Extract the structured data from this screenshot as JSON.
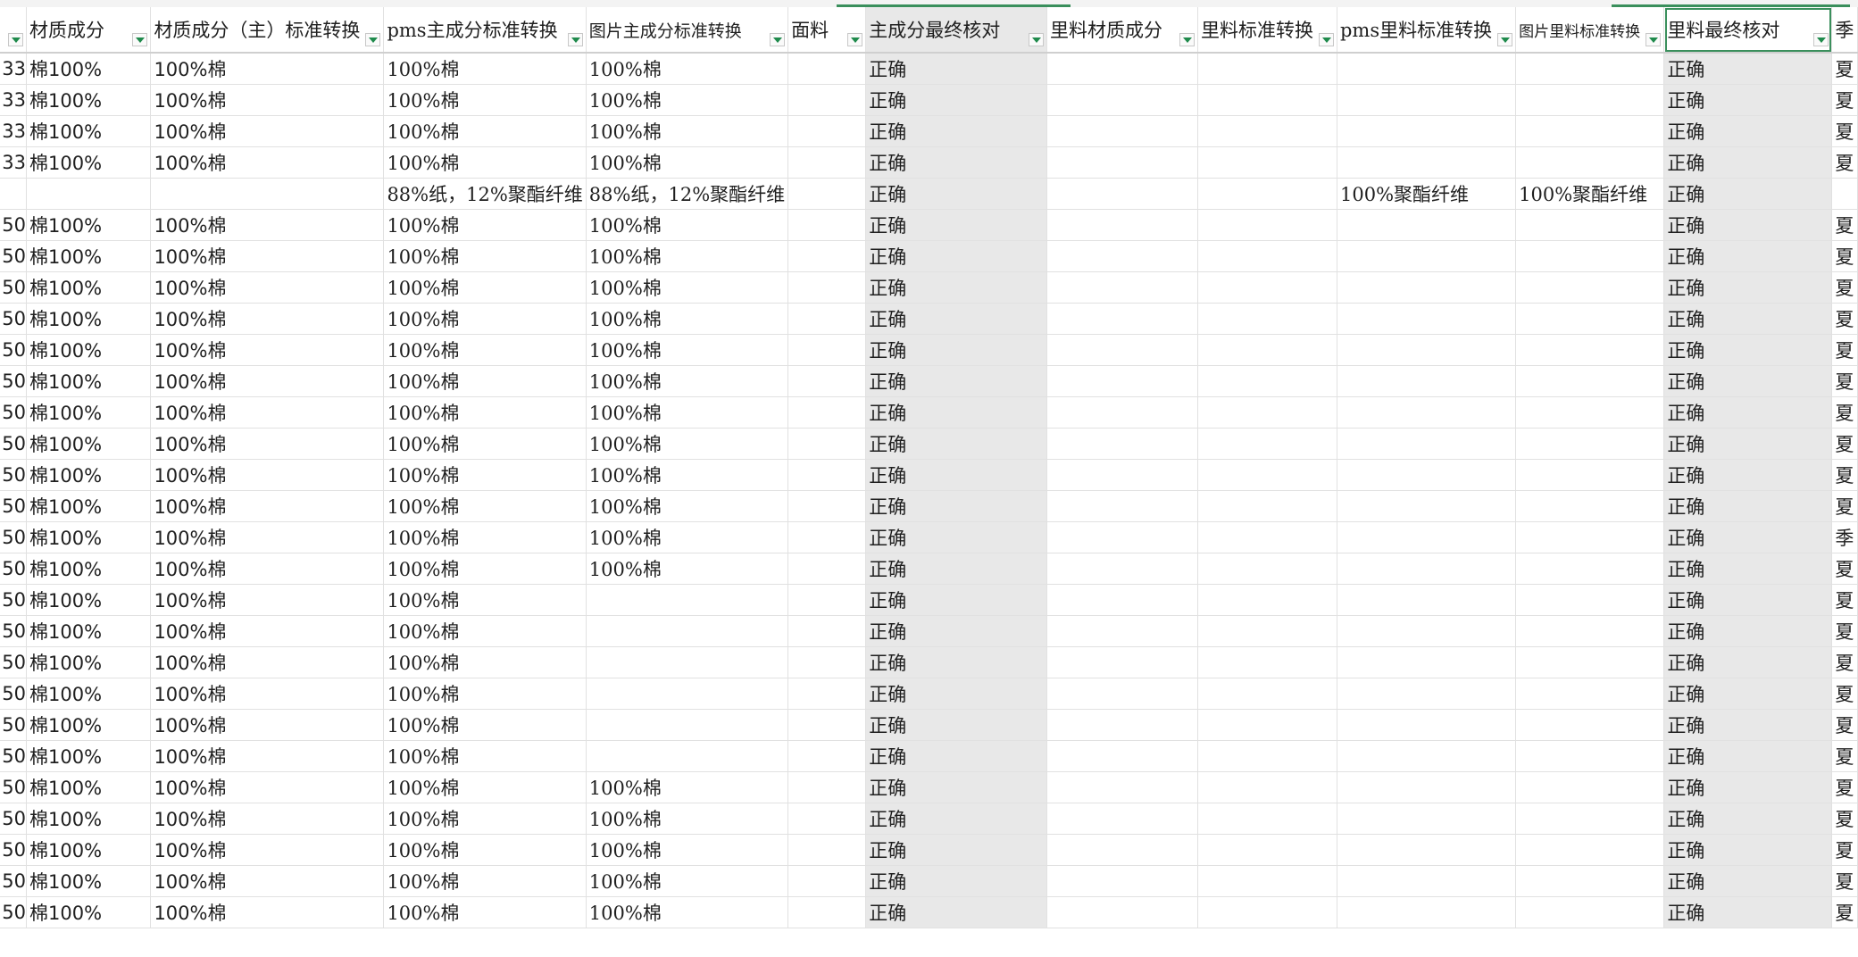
{
  "headers": [
    "",
    "材质成分",
    "材质成分（主）标准转换",
    "pms主成分标准转换",
    "图片主成分标准转换",
    "面料",
    "主成分最终核对",
    "里料材质成分",
    "里料标准转换",
    "pms里料标准转换",
    "图片里料标准转换",
    "里料最终核对",
    "季"
  ],
  "rows": [
    [
      "33",
      "棉100%",
      "100%棉",
      "100%棉",
      "100%棉",
      "",
      "正确",
      "",
      "",
      "",
      "",
      "正确",
      "夏"
    ],
    [
      "33",
      "棉100%",
      "100%棉",
      "100%棉",
      "100%棉",
      "",
      "正确",
      "",
      "",
      "",
      "",
      "正确",
      "夏"
    ],
    [
      "33",
      "棉100%",
      "100%棉",
      "100%棉",
      "100%棉",
      "",
      "正确",
      "",
      "",
      "",
      "",
      "正确",
      "夏"
    ],
    [
      "33",
      "棉100%",
      "100%棉",
      "100%棉",
      "100%棉",
      "",
      "正确",
      "",
      "",
      "",
      "",
      "正确",
      "夏"
    ],
    [
      "",
      "",
      "",
      "88%纸，12%聚酯纤维",
      "88%纸，12%聚酯纤维",
      "",
      "正确",
      "",
      "",
      "100%聚酯纤维",
      "100%聚酯纤维",
      "正确",
      ""
    ],
    [
      "50",
      "棉100%",
      "100%棉",
      "100%棉",
      "100%棉",
      "",
      "正确",
      "",
      "",
      "",
      "",
      "正确",
      "夏"
    ],
    [
      "50",
      "棉100%",
      "100%棉",
      "100%棉",
      "100%棉",
      "",
      "正确",
      "",
      "",
      "",
      "",
      "正确",
      "夏"
    ],
    [
      "50",
      "棉100%",
      "100%棉",
      "100%棉",
      "100%棉",
      "",
      "正确",
      "",
      "",
      "",
      "",
      "正确",
      "夏"
    ],
    [
      "50",
      "棉100%",
      "100%棉",
      "100%棉",
      "100%棉",
      "",
      "正确",
      "",
      "",
      "",
      "",
      "正确",
      "夏"
    ],
    [
      "50",
      "棉100%",
      "100%棉",
      "100%棉",
      "100%棉",
      "",
      "正确",
      "",
      "",
      "",
      "",
      "正确",
      "夏"
    ],
    [
      "50",
      "棉100%",
      "100%棉",
      "100%棉",
      "100%棉",
      "",
      "正确",
      "",
      "",
      "",
      "",
      "正确",
      "夏"
    ],
    [
      "50",
      "棉100%",
      "100%棉",
      "100%棉",
      "100%棉",
      "",
      "正确",
      "",
      "",
      "",
      "",
      "正确",
      "夏"
    ],
    [
      "50",
      "棉100%",
      "100%棉",
      "100%棉",
      "100%棉",
      "",
      "正确",
      "",
      "",
      "",
      "",
      "正确",
      "夏"
    ],
    [
      "50",
      "棉100%",
      "100%棉",
      "100%棉",
      "100%棉",
      "",
      "正确",
      "",
      "",
      "",
      "",
      "正确",
      "夏"
    ],
    [
      "50",
      "棉100%",
      "100%棉",
      "100%棉",
      "100%棉",
      "",
      "正确",
      "",
      "",
      "",
      "",
      "正确",
      "夏"
    ],
    [
      "50",
      "棉100%",
      "100%棉",
      "100%棉",
      "100%棉",
      "",
      "正确",
      "",
      "",
      "",
      "",
      "正确",
      "季"
    ],
    [
      "50",
      "棉100%",
      "100%棉",
      "100%棉",
      "100%棉",
      "",
      "正确",
      "",
      "",
      "",
      "",
      "正确",
      "夏"
    ],
    [
      "50",
      "棉100%",
      "100%棉",
      "100%棉",
      "",
      "",
      "正确",
      "",
      "",
      "",
      "",
      "正确",
      "夏"
    ],
    [
      "50",
      "棉100%",
      "100%棉",
      "100%棉",
      "",
      "",
      "正确",
      "",
      "",
      "",
      "",
      "正确",
      "夏"
    ],
    [
      "50",
      "棉100%",
      "100%棉",
      "100%棉",
      "",
      "",
      "正确",
      "",
      "",
      "",
      "",
      "正确",
      "夏"
    ],
    [
      "50",
      "棉100%",
      "100%棉",
      "100%棉",
      "",
      "",
      "正确",
      "",
      "",
      "",
      "",
      "正确",
      "夏"
    ],
    [
      "50",
      "棉100%",
      "100%棉",
      "100%棉",
      "",
      "",
      "正确",
      "",
      "",
      "",
      "",
      "正确",
      "夏"
    ],
    [
      "50",
      "棉100%",
      "100%棉",
      "100%棉",
      "",
      "",
      "正确",
      "",
      "",
      "",
      "",
      "正确",
      "夏"
    ],
    [
      "50",
      "棉100%",
      "100%棉",
      "100%棉",
      "100%棉",
      "",
      "正确",
      "",
      "",
      "",
      "",
      "正确",
      "夏"
    ],
    [
      "50",
      "棉100%",
      "100%棉",
      "100%棉",
      "100%棉",
      "",
      "正确",
      "",
      "",
      "",
      "",
      "正确",
      "夏"
    ],
    [
      "50",
      "棉100%",
      "100%棉",
      "100%棉",
      "100%棉",
      "",
      "正确",
      "",
      "",
      "",
      "",
      "正确",
      "夏"
    ],
    [
      "50",
      "棉100%",
      "100%棉",
      "100%棉",
      "100%棉",
      "",
      "正确",
      "",
      "",
      "",
      "",
      "正确",
      "夏"
    ],
    [
      "50",
      "棉100%",
      "100%棉",
      "100%棉",
      "100%棉",
      "",
      "正确",
      "",
      "",
      "",
      "",
      "正确",
      "夏"
    ]
  ],
  "colors": {
    "accent": "#3a8f5c",
    "filter_arrow": "#1f8a4c",
    "highlight_column": "#e8e8e8",
    "grid_line": "#e1e1e1"
  }
}
